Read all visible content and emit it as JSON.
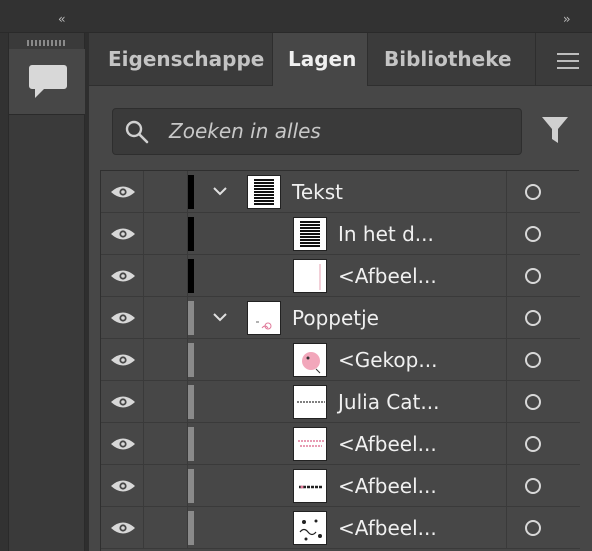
{
  "topbar": {
    "collapse_left": "‹‹",
    "collapse_right": "››"
  },
  "tabs": [
    {
      "label": "Eigenschappen"
    },
    {
      "label": "Lagen"
    },
    {
      "label": "Bibliotheken"
    }
  ],
  "search": {
    "placeholder": "Zoeken in alles"
  },
  "colors": {
    "panel_bg": "#474747",
    "tab_bar_bg": "#3b3b3b",
    "layer_color_black": "#000000",
    "layer_color_gray": "#8a8a8a",
    "text": "#f0f0f0"
  },
  "layers": [
    {
      "label": "Tekst",
      "expandable": true,
      "color": "black",
      "thumb": "text-block"
    },
    {
      "label": "In het d...",
      "expandable": false,
      "color": "black",
      "thumb": "text-block"
    },
    {
      "label": "<Afbeel...",
      "expandable": false,
      "color": "black",
      "thumb": "blank-line"
    },
    {
      "label": "Poppetje",
      "expandable": true,
      "color": "gray",
      "thumb": "pink-sketch"
    },
    {
      "label": "<Gekop...",
      "expandable": false,
      "color": "gray",
      "thumb": "pink-blob"
    },
    {
      "label": "Julia Cat...",
      "expandable": false,
      "color": "gray",
      "thumb": "text-line"
    },
    {
      "label": "<Afbeel...",
      "expandable": false,
      "color": "gray",
      "thumb": "pink-text"
    },
    {
      "label": "<Afbeel...",
      "expandable": false,
      "color": "gray",
      "thumb": "black-text-line"
    },
    {
      "label": "<Afbeel...",
      "expandable": false,
      "color": "gray",
      "thumb": "doodles"
    }
  ]
}
